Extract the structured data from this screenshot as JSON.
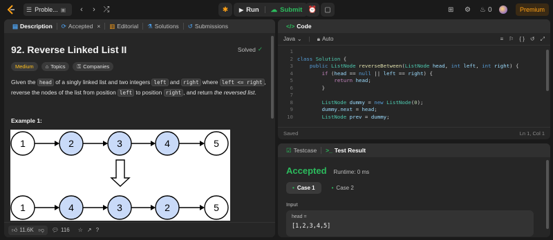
{
  "topbar": {
    "problem_tab": "Proble...",
    "run_label": "Run",
    "submit_label": "Submit",
    "fire_count": "0",
    "premium_label": "Premium",
    "colors": {
      "submit": "#2cbb5d",
      "premium": "#ffa116"
    }
  },
  "left_panel": {
    "tabs": [
      {
        "label": "Description"
      },
      {
        "label": "Accepted"
      },
      {
        "label": "Editorial"
      },
      {
        "label": "Solutions"
      },
      {
        "label": "Submissions"
      }
    ],
    "title": "92. Reverse Linked List II",
    "solved_label": "Solved",
    "tags": {
      "difficulty": "Medium",
      "topics": "Topics",
      "companies": "Companies"
    },
    "description": {
      "p1": "Given the ",
      "code_head": "head",
      "p2": " of a singly linked list and two integers ",
      "code_left": "left",
      "p3": " and ",
      "code_right": "right",
      "p4": " where ",
      "code_cond": "left <= right",
      "p5": ",",
      "p6": "reverse the nodes of the list from position ",
      "code_left2": "left",
      "p7": " to position ",
      "code_right2": "right",
      "p8": ", and return ",
      "em": "the reversed list",
      "p9": "."
    },
    "example_heading": "Example 1:",
    "diagram": {
      "top_row": [
        "1",
        "2",
        "3",
        "4",
        "5"
      ],
      "bottom_row": [
        "1",
        "4",
        "3",
        "2",
        "5"
      ]
    },
    "footer": {
      "likes": "11.6K",
      "comments": "116"
    }
  },
  "code_panel": {
    "header": "Code",
    "language": "Java",
    "auto_label": "Auto",
    "lines": [
      {
        "n": "1"
      },
      {
        "n": "2"
      },
      {
        "n": "3"
      },
      {
        "n": "4"
      },
      {
        "n": "5"
      },
      {
        "n": "6"
      },
      {
        "n": "7"
      },
      {
        "n": "8"
      },
      {
        "n": "9"
      },
      {
        "n": "10"
      }
    ],
    "status_saved": "Saved",
    "cursor": "Ln 1, Col 1"
  },
  "result_panel": {
    "tabs": {
      "testcase": "Testcase",
      "result": "Test Result"
    },
    "status": "Accepted",
    "runtime": "Runtime: 0 ms",
    "cases": [
      "Case 1",
      "Case 2"
    ],
    "input_label": "Input",
    "var_name": "head =",
    "var_value": "[1,2,3,4,5]"
  }
}
